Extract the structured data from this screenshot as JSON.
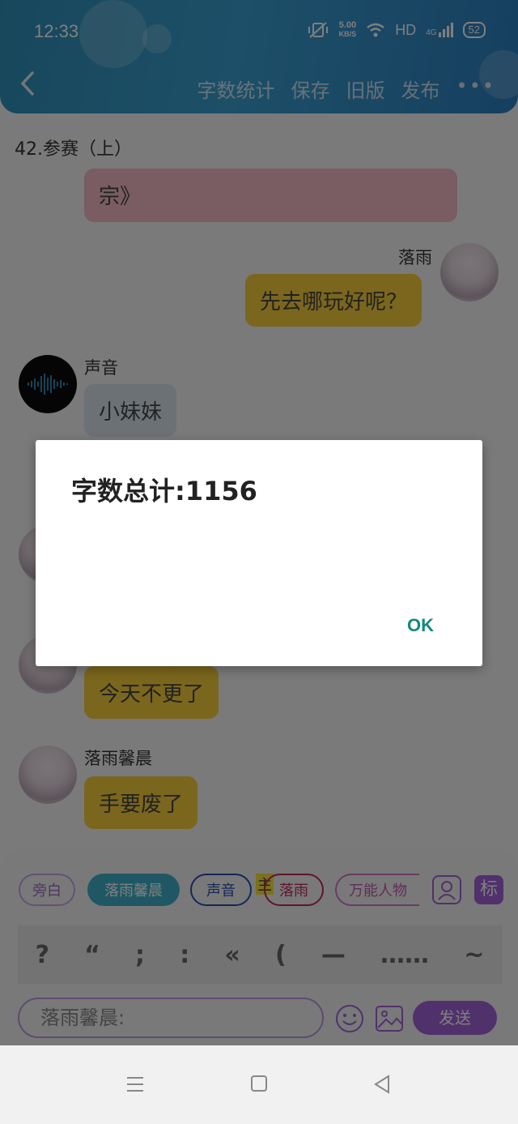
{
  "status_bar": {
    "time": "12:33",
    "net_speed_value": "5.00",
    "net_speed_unit": "KB/S",
    "hd": "HD",
    "network": "4G",
    "battery": "52"
  },
  "toolbar": {
    "word_count_label": "字数统计",
    "save_label": "保存",
    "old_version_label": "旧版",
    "publish_label": "发布",
    "more_label": "•••"
  },
  "chapter_title": "42.参赛（上）",
  "messages": {
    "m1": {
      "text": "宗》"
    },
    "m2": {
      "sender": "落雨",
      "text": "先去哪玩好呢？"
    },
    "m3": {
      "sender": "声音",
      "text": "小妹妹"
    },
    "m4": {
      "text": "今天不更了"
    },
    "m5": {
      "sender": "落雨馨晨",
      "text": "手要废了"
    }
  },
  "dialog": {
    "title": "字数总计:1156",
    "ok_label": "OK"
  },
  "roles": {
    "narration": "旁白",
    "luoyu_xinchen": "落雨馨晨",
    "sound": "声音",
    "main_badge": "主",
    "luoyu": "落雨",
    "universal": "万能人物",
    "mark": "标"
  },
  "punctuation": [
    "?",
    "“",
    ";",
    ":",
    "«",
    "(",
    "—",
    "……",
    "~"
  ],
  "input": {
    "value": "落雨馨晨:"
  },
  "send_label": "发送",
  "colors": {
    "accent": "#a063d6",
    "header": "#3a9fd0",
    "ok": "#118a7e"
  }
}
